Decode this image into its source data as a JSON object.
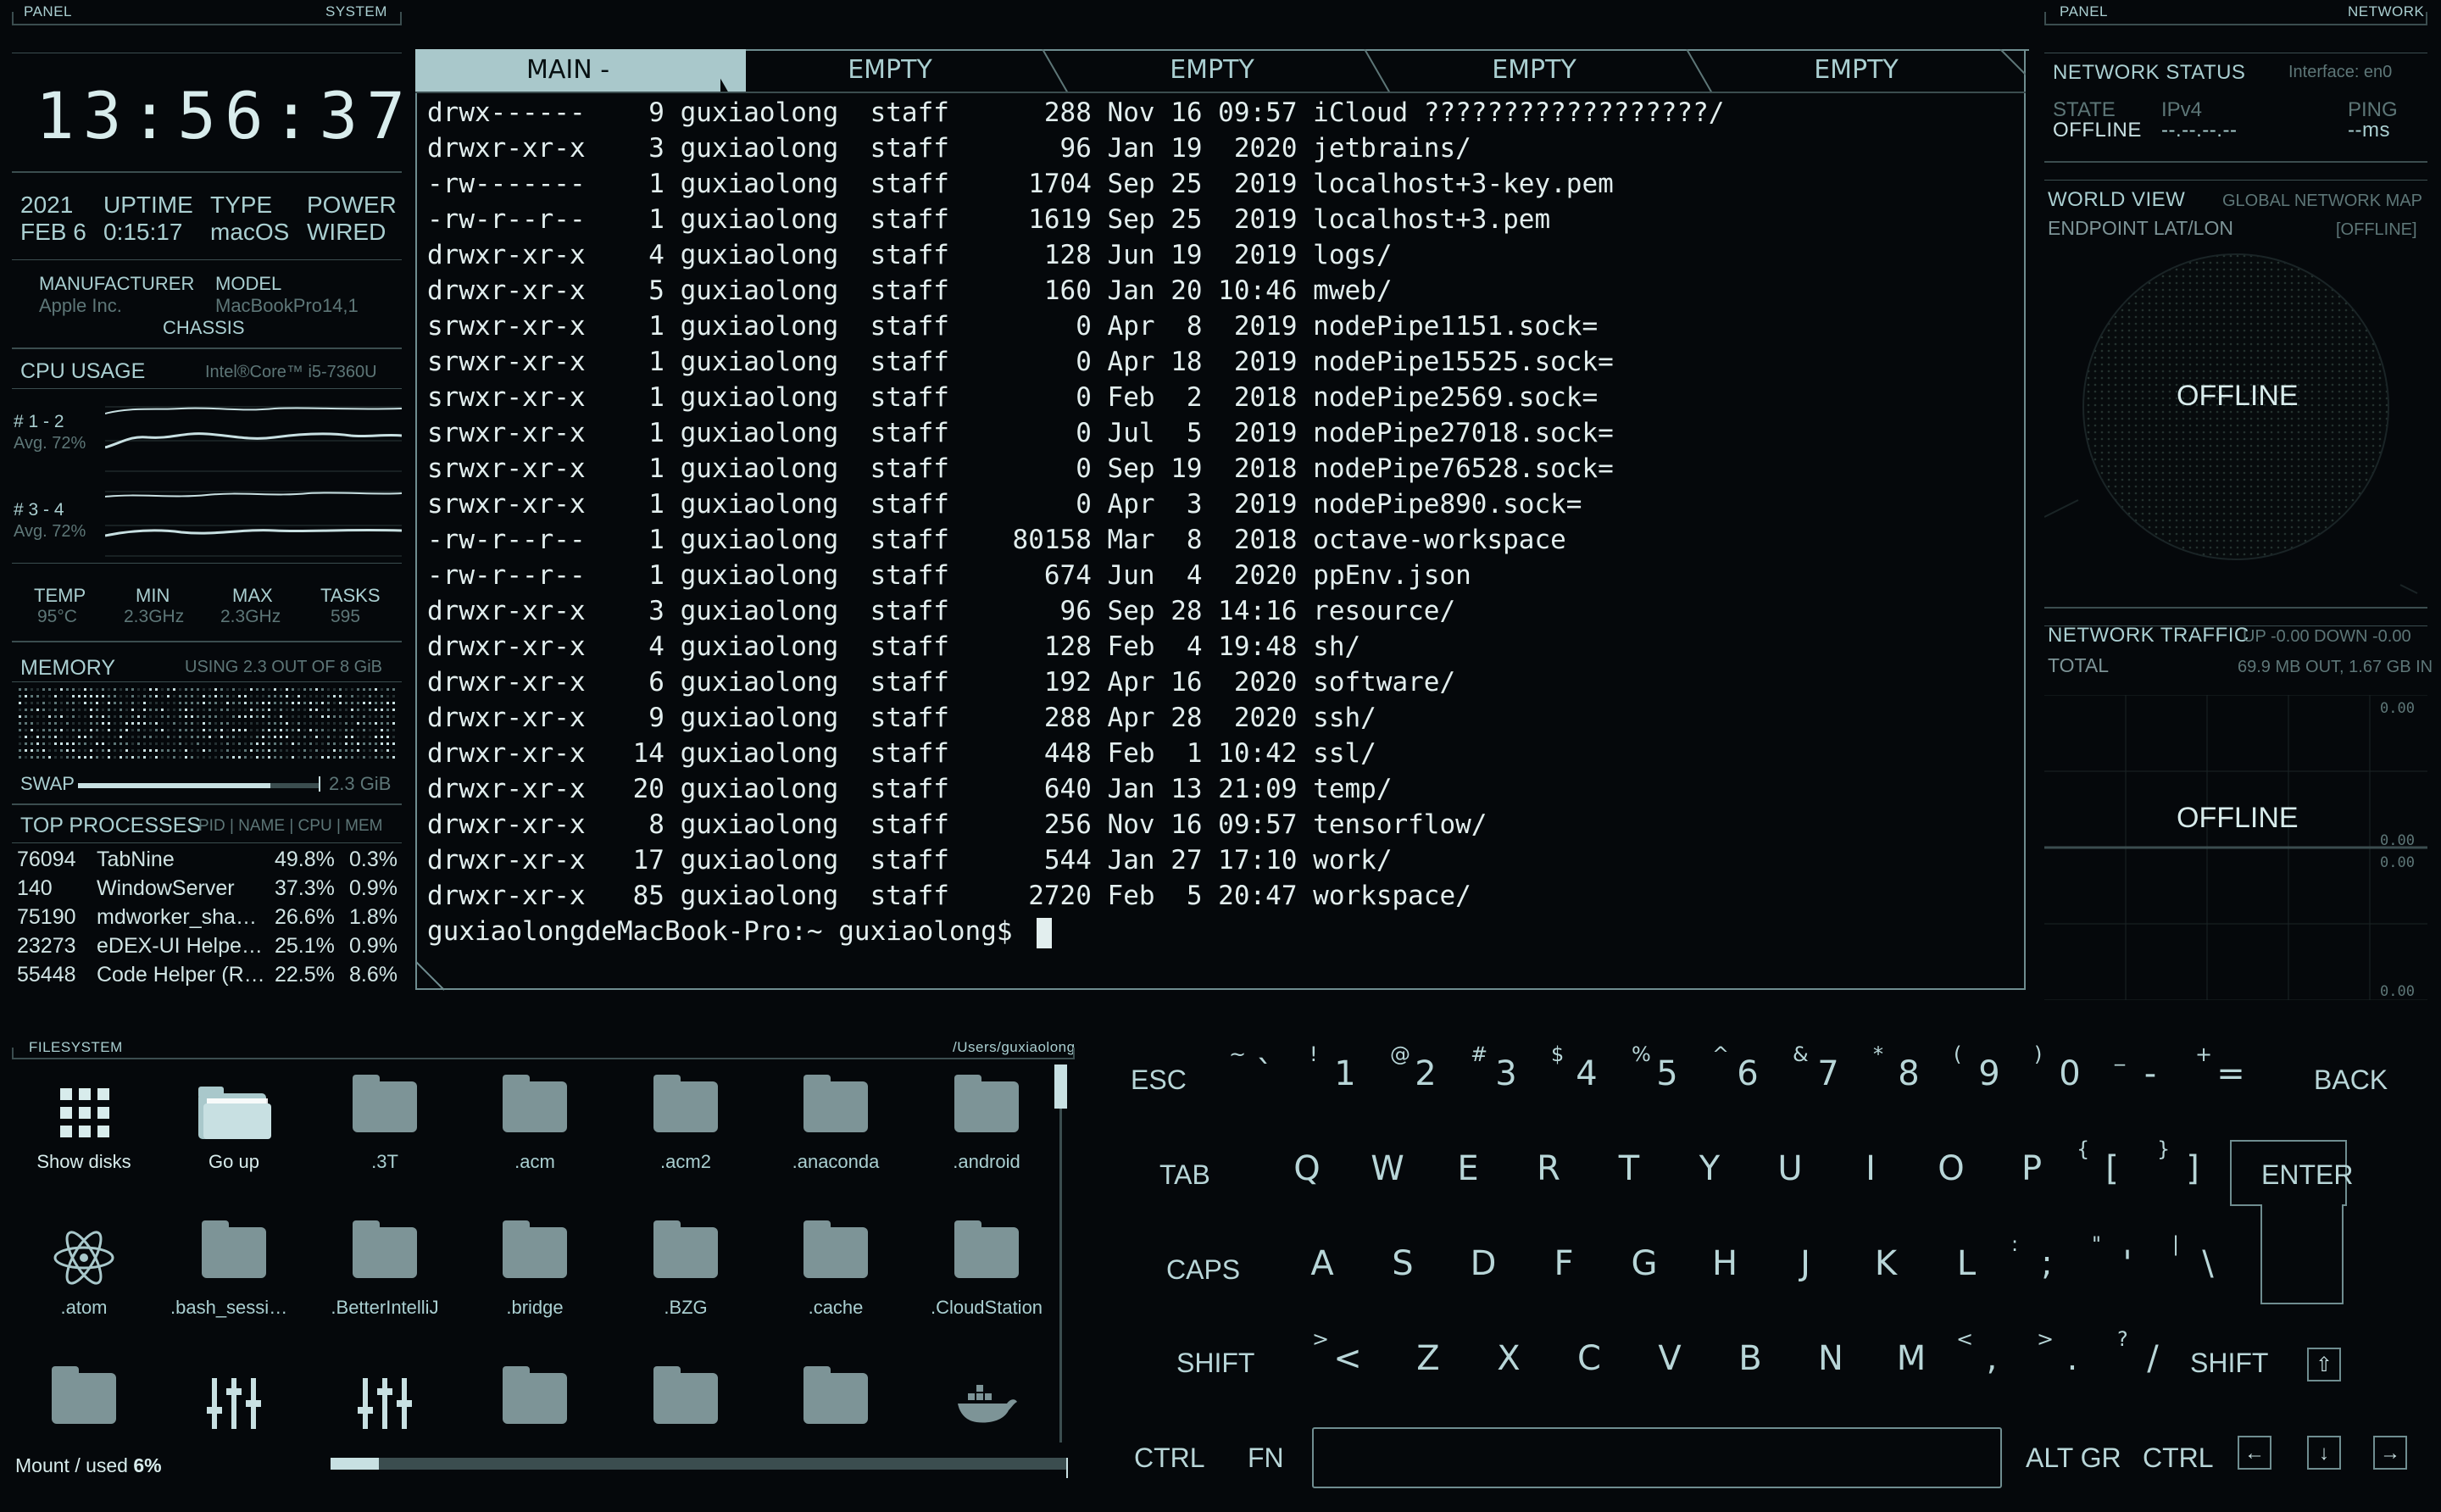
{
  "left_panel": {
    "header_left": "PANEL",
    "header_right": "SYSTEM",
    "clock": "13:56:37",
    "sys": {
      "labels": [
        "2021",
        "UPTIME",
        "TYPE",
        "POWER"
      ],
      "values": [
        "FEB 6",
        "0:15:17",
        "macOS",
        "WIRED"
      ]
    },
    "hw": {
      "manufacturer_label": "MANUFACTURER",
      "manufacturer": "Apple Inc.",
      "model_label": "MODEL",
      "model": "MacBookPro14,1",
      "chassis_label": "CHASSIS"
    },
    "cpu": {
      "title": "CPU USAGE",
      "model": "Intel®Core™ i5-7360U",
      "group1": "# 1 - 2",
      "group1_avg": "Avg. 72%",
      "group2": "# 3 - 4",
      "group2_avg": "Avg. 72%",
      "stats_labels": [
        "TEMP",
        "MIN",
        "MAX",
        "TASKS"
      ],
      "stats_values": [
        "95°C",
        "2.3GHz",
        "2.3GHz",
        "595"
      ]
    },
    "memory": {
      "title": "MEMORY",
      "usage": "USING 2.3 OUT OF 8 GiB",
      "swap_label": "SWAP",
      "swap_value": "2.3 GiB",
      "swap_fraction": 0.8
    },
    "processes": {
      "title": "TOP PROCESSES",
      "columns": "PID | NAME | CPU | MEM",
      "rows": [
        {
          "pid": "76094",
          "name": "TabNine",
          "cpu": "49.8%",
          "mem": "0.3%"
        },
        {
          "pid": "140",
          "name": "WindowServer",
          "cpu": "37.3%",
          "mem": "0.9%"
        },
        {
          "pid": "75190",
          "name": "mdworker_sha…",
          "cpu": "26.6%",
          "mem": "1.8%"
        },
        {
          "pid": "23273",
          "name": "eDEX-UI Helpe…",
          "cpu": "25.1%",
          "mem": "0.9%"
        },
        {
          "pid": "55448",
          "name": "Code Helper (R…",
          "cpu": "22.5%",
          "mem": "8.6%"
        }
      ]
    }
  },
  "terminal": {
    "tabs": [
      "MAIN -",
      "EMPTY",
      "EMPTY",
      "EMPTY",
      "EMPTY"
    ],
    "lines": [
      "drwx------    9 guxiaolong  staff      288 Nov 16 09:57 iCloud ??????????????????/",
      "drwxr-xr-x    3 guxiaolong  staff       96 Jan 19  2020 jetbrains/",
      "-rw-------    1 guxiaolong  staff     1704 Sep 25  2019 localhost+3-key.pem",
      "-rw-r--r--    1 guxiaolong  staff     1619 Sep 25  2019 localhost+3.pem",
      "drwxr-xr-x    4 guxiaolong  staff      128 Jun 19  2019 logs/",
      "drwxr-xr-x    5 guxiaolong  staff      160 Jan 20 10:46 mweb/",
      "srwxr-xr-x    1 guxiaolong  staff        0 Apr  8  2019 nodePipe1151.sock=",
      "srwxr-xr-x    1 guxiaolong  staff        0 Apr 18  2019 nodePipe15525.sock=",
      "srwxr-xr-x    1 guxiaolong  staff        0 Feb  2  2018 nodePipe2569.sock=",
      "srwxr-xr-x    1 guxiaolong  staff        0 Jul  5  2019 nodePipe27018.sock=",
      "srwxr-xr-x    1 guxiaolong  staff        0 Sep 19  2018 nodePipe76528.sock=",
      "srwxr-xr-x    1 guxiaolong  staff        0 Apr  3  2019 nodePipe890.sock=",
      "-rw-r--r--    1 guxiaolong  staff    80158 Mar  8  2018 octave-workspace",
      "-rw-r--r--    1 guxiaolong  staff      674 Jun  4  2020 ppEnv.json",
      "drwxr-xr-x    3 guxiaolong  staff       96 Sep 28 14:16 resource/",
      "drwxr-xr-x    4 guxiaolong  staff      128 Feb  4 19:48 sh/",
      "drwxr-xr-x    6 guxiaolong  staff      192 Apr 16  2020 software/",
      "drwxr-xr-x    9 guxiaolong  staff      288 Apr 28  2020 ssh/",
      "drwxr-xr-x   14 guxiaolong  staff      448 Feb  1 10:42 ssl/",
      "drwxr-xr-x   20 guxiaolong  staff      640 Jan 13 21:09 temp/",
      "drwxr-xr-x    8 guxiaolong  staff      256 Nov 16 09:57 tensorflow/",
      "drwxr-xr-x   17 guxiaolong  staff      544 Jan 27 17:10 work/",
      "drwxr-xr-x   85 guxiaolong  staff     2720 Feb  5 20:47 workspace/"
    ],
    "prompt": "guxiaolongdeMacBook-Pro:~ guxiaolong$ "
  },
  "right_panel": {
    "header_left": "PANEL",
    "header_right": "NETWORK",
    "status_title": "NETWORK STATUS",
    "interface": "Interface: en0",
    "state_label": "STATE",
    "state_value": "OFFLINE",
    "ipv4_label": "IPv4",
    "ipv4_value": "--.--.--.--",
    "ping_label": "PING",
    "ping_value": "--ms",
    "world_title": "WORLD VIEW",
    "world_sub": "GLOBAL NETWORK MAP",
    "endpoint_label": "ENDPOINT LAT/LON",
    "endpoint_value": "[OFFLINE]",
    "globe_status": "OFFLINE",
    "traffic_title": "NETWORK TRAFFIC",
    "traffic_updown": "UP -0.00 DOWN -0.00",
    "total_label": "TOTAL",
    "total_value": "69.9 MB OUT, 1.67 GB IN",
    "traffic_status": "OFFLINE",
    "chart_ticks": [
      "0.00",
      "0.00",
      "0.00",
      "0.00"
    ]
  },
  "filesystem": {
    "header_left": "FILESYSTEM",
    "path": "/Users/guxiaolong",
    "items": [
      {
        "label": "Show disks",
        "icon": "grid-icon"
      },
      {
        "label": "Go up",
        "icon": "folder-open-icon"
      },
      {
        "label": ".3T",
        "icon": "folder-icon"
      },
      {
        "label": ".acm",
        "icon": "folder-icon"
      },
      {
        "label": ".acm2",
        "icon": "folder-icon"
      },
      {
        "label": ".anaconda",
        "icon": "folder-icon"
      },
      {
        "label": ".android",
        "icon": "folder-icon"
      },
      {
        "label": ".atom",
        "icon": "atom-icon"
      },
      {
        "label": ".bash_sessio…",
        "icon": "folder-icon"
      },
      {
        "label": ".BetterIntelliJ",
        "icon": "folder-icon"
      },
      {
        "label": ".bridge",
        "icon": "folder-icon"
      },
      {
        "label": ".BZG",
        "icon": "folder-icon"
      },
      {
        "label": ".cache",
        "icon": "folder-icon"
      },
      {
        "label": ".CloudStation",
        "icon": "folder-icon"
      },
      {
        "label": "",
        "icon": "folder-icon"
      },
      {
        "label": "",
        "icon": "sliders-icon"
      },
      {
        "label": "",
        "icon": "sliders-icon"
      },
      {
        "label": "",
        "icon": "folder-icon"
      },
      {
        "label": "",
        "icon": "folder-icon"
      },
      {
        "label": "",
        "icon": "folder-icon"
      },
      {
        "label": "",
        "icon": "docker-icon"
      }
    ],
    "mount_label": "Mount / used",
    "mount_value": "6%",
    "mount_fraction": 0.06
  },
  "keyboard": {
    "row1": [
      {
        "sup": "~",
        "main": "`"
      },
      {
        "sup": "!",
        "main": "1"
      },
      {
        "sup": "@",
        "main": "2"
      },
      {
        "sup": "#",
        "main": "3"
      },
      {
        "sup": "$",
        "main": "4"
      },
      {
        "sup": "%",
        "main": "5"
      },
      {
        "sup": "^",
        "main": "6"
      },
      {
        "sup": "&",
        "main": "7"
      },
      {
        "sup": "*",
        "main": "8"
      },
      {
        "sup": "(",
        "main": "9"
      },
      {
        "sup": ")",
        "main": "0"
      },
      {
        "sup": "_",
        "main": "-"
      },
      {
        "sup": "+",
        "main": "="
      }
    ],
    "row2": [
      {
        "sup": "",
        "main": "Q"
      },
      {
        "sup": "",
        "main": "W"
      },
      {
        "sup": "",
        "main": "E"
      },
      {
        "sup": "",
        "main": "R"
      },
      {
        "sup": "",
        "main": "T"
      },
      {
        "sup": "",
        "main": "Y"
      },
      {
        "sup": "",
        "main": "U"
      },
      {
        "sup": "",
        "main": "I"
      },
      {
        "sup": "",
        "main": "O"
      },
      {
        "sup": "",
        "main": "P"
      },
      {
        "sup": "{",
        "main": "["
      },
      {
        "sup": "}",
        "main": "]"
      }
    ],
    "row3": [
      {
        "sup": "",
        "main": "A"
      },
      {
        "sup": "",
        "main": "S"
      },
      {
        "sup": "",
        "main": "D"
      },
      {
        "sup": "",
        "main": "F"
      },
      {
        "sup": "",
        "main": "G"
      },
      {
        "sup": "",
        "main": "H"
      },
      {
        "sup": "",
        "main": "J"
      },
      {
        "sup": "",
        "main": "K"
      },
      {
        "sup": "",
        "main": "L"
      },
      {
        "sup": ":",
        "main": ";"
      },
      {
        "sup": "\"",
        "main": "'"
      },
      {
        "sup": "|",
        "main": "\\"
      }
    ],
    "row4": [
      {
        "sup": ">",
        "main": "<"
      },
      {
        "sup": "",
        "main": "Z"
      },
      {
        "sup": "",
        "main": "X"
      },
      {
        "sup": "",
        "main": "C"
      },
      {
        "sup": "",
        "main": "V"
      },
      {
        "sup": "",
        "main": "B"
      },
      {
        "sup": "",
        "main": "N"
      },
      {
        "sup": "",
        "main": "M"
      },
      {
        "sup": "<",
        "main": ","
      },
      {
        "sup": ">",
        "main": "."
      },
      {
        "sup": "?",
        "main": "/"
      }
    ],
    "esc": "ESC",
    "back": "BACK",
    "tab": "TAB",
    "enter": "ENTER",
    "caps": "CAPS",
    "shift_l": "SHIFT",
    "shift_r": "SHIFT",
    "ctrl_l": "CTRL",
    "fn": "FN",
    "altgr": "ALT GR",
    "ctrl_r": "CTRL"
  }
}
